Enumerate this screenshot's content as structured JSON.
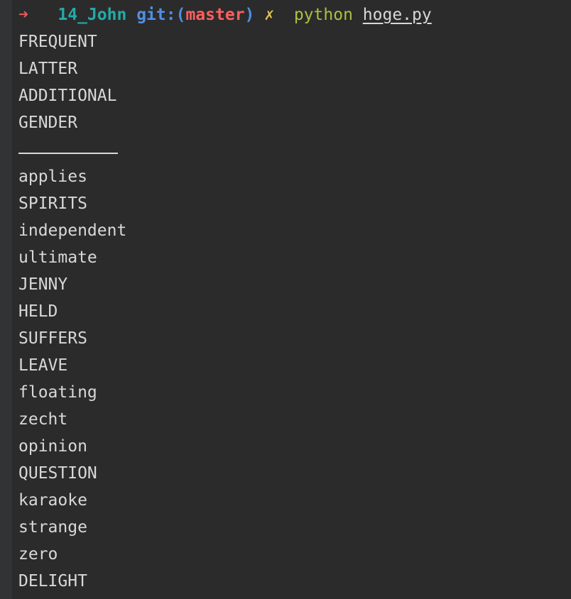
{
  "prompt": {
    "arrow": "➜",
    "directory": "14_John",
    "git_label": "git:(",
    "branch": "master",
    "git_close": ")",
    "dirty_mark": "✗",
    "command": "python",
    "argument": "hoge.py"
  },
  "output_before_separator": [
    "FREQUENT",
    "LATTER",
    "ADDITIONAL",
    "GENDER"
  ],
  "separator": "__________",
  "output_after_separator": [
    "applies",
    "SPIRITS",
    "independent",
    "ultimate",
    "JENNY",
    "HELD",
    "SUFFERS",
    "LEAVE",
    "floating",
    "zecht",
    "opinion",
    "QUESTION",
    "karaoke",
    "strange",
    "zero",
    "DELIGHT"
  ],
  "colors": {
    "background": "#2b2b2b",
    "text": "#d8d8d8",
    "arrow": "#e8575a",
    "directory": "#25a9a9",
    "git": "#4f8fe6",
    "branch": "#ff5f5f",
    "dirty": "#e8c050",
    "command": "#a9c23f"
  }
}
